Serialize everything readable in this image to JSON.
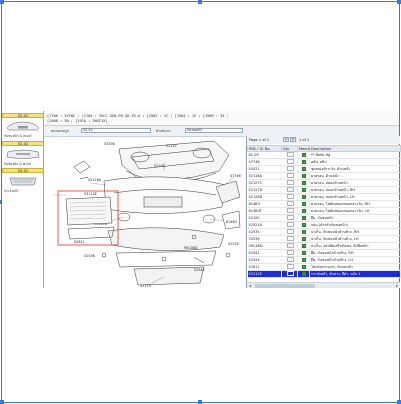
{
  "info": {
    "line1": "[1706 : 34TWC ; (1704 : 3GCC.GEN.PH.SA.YR.A ; [1902 : 1C ; [1904 : 1F ; [1909 : 34 ;",
    "line2": "[1908 : 3B ; [1910 : 3NSF15]"
  },
  "search": {
    "label1": "หมายเลขรูป",
    "field1": "52-01",
    "label2": "คำอธิบาย",
    "field2": "กันชนหน้า"
  },
  "thumbs": [
    {
      "tab": "52-01",
      "caption": "กันชนหน้า & สเปอร์"
    },
    {
      "tab": "52-02",
      "caption": "กันชนหลัง & สเปอร์"
    },
    {
      "tab": "53-01",
      "caption": "กระจังหน้า"
    }
  ],
  "parts": {
    "header_label": "Page 1 of 1",
    "nav_prev": "<",
    "nav_next": ">",
    "page": "1 of 1",
    "columns": [
      "PNC / Ill. No.",
      "Qty",
      "Memo",
      "Description"
    ],
    "rows": [
      {
        "pnc": "81-09",
        "desc": "** Refer fig"
      },
      {
        "pnc": "47746",
        "desc": "คลิป, สลิป"
      },
      {
        "pnc": "53021",
        "desc": "ชุดสเปอร์กระจัง, ด้านหน้า"
      },
      {
        "pnc": "52116A",
        "desc": "ฝาครอบ, ด้านหน้า"
      },
      {
        "pnc": "52127C",
        "desc": "ฝาครอบ, ปลอกด้านหน้า"
      },
      {
        "pnc": "52127D",
        "desc": "ฝาครอบ, ปลอกด้านหน้า, RH"
      },
      {
        "pnc": "52128B",
        "desc": "ฝาครอบ, ปลอกด้านหน้า, LH"
      },
      {
        "pnc": "814B3",
        "desc": "ฝาครอบ, ไฟตัดหมอกตอนกลางวัน, RH"
      },
      {
        "pnc": "814B4T",
        "desc": "ฝาครอบ, ไฟตัดหมอกตอนกลางวัน, LH"
      },
      {
        "pnc": "5210C",
        "desc": "ยึด, กันชนหน้า"
      },
      {
        "pnc": "52521A",
        "desc": "แผ่น (สำหรับกันชนหน้า)"
      },
      {
        "pnc": "52535",
        "desc": "ปะเก็น, กันชนหน้าด้านข้าง, RH"
      },
      {
        "pnc": "52536",
        "desc": "ปะเก็น, กันชนหน้าด้านข้าง, LH"
      },
      {
        "pnc": "90C48D",
        "desc": "ปะเก็น, แผ่นปิดเสริมกันชน, ตัวยึดหน้า"
      },
      {
        "pnc": "52541",
        "desc": "ยึด, กันชนหน้าด้านข้าง, RH"
      },
      {
        "pnc": "52544",
        "desc": "ยึด, กันชนหน้าด้านข้าง, LH"
      },
      {
        "pnc": "52611",
        "desc": "โฟมกันกระแทก, กันชนหน้า"
      },
      {
        "pnc": "53112E",
        "desc": "กระจังหน้า, ตัวล่าง, สีดำ, ฉบับ 1",
        "selected": true
      }
    ]
  },
  "diagram": {
    "labels": [
      "53112E",
      "52611",
      "52119",
      "52535",
      "52536",
      "52541",
      "52544",
      "47746",
      "53021",
      "52127",
      "814B3",
      "52521A",
      "5210C",
      "90C48D",
      "52116A"
    ]
  },
  "colors": {
    "selection": "#1f2bd6",
    "frame": "#3b78d8",
    "highlight_box": "#e0322c",
    "tab_yellow": "#f3e37c"
  }
}
